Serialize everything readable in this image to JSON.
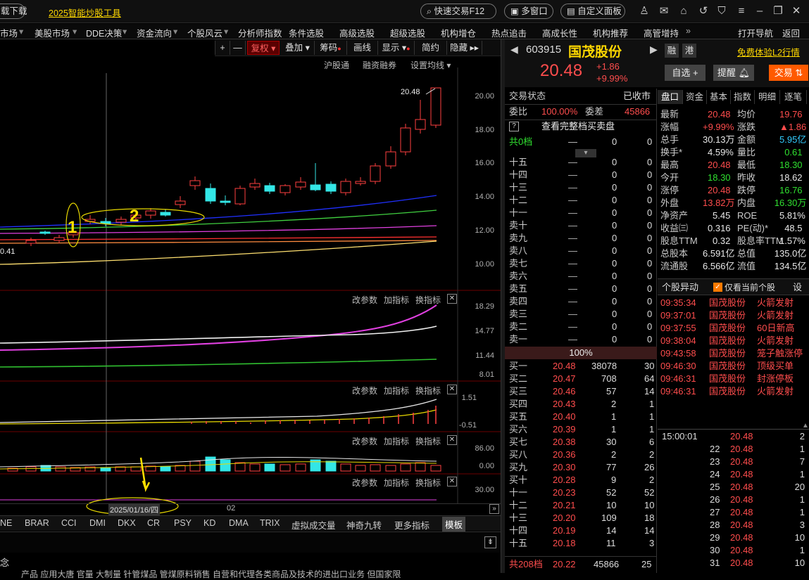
{
  "top": {
    "download": "载下载",
    "promo": "2025智能炒股工具",
    "quick_trade": "快速交易F12",
    "multi_window": "多窗口",
    "custom_panel": "自定义面板"
  },
  "menu": [
    "市场",
    "美股市场",
    "DDE决策",
    "资金流向",
    "个股风云",
    "分析师指数",
    "条件选股",
    "高级选股",
    "超级选股",
    "机构增仓",
    "热点追击",
    "高成长性",
    "机构推荐",
    "高管增持",
    "»",
    "打开导航",
    "返回"
  ],
  "chart_toolbar": {
    "plus": "+",
    "minus": "—",
    "fuquan": "复权",
    "diejia": "叠加",
    "chouma": "筹码",
    "huaxian": "画线",
    "xianshi": "显示",
    "jianyue": "简约",
    "yincang": "隐藏"
  },
  "chart_sub": {
    "hgt": "沪股通",
    "rzrq": "融资融券",
    "ma_set": "设置均线"
  },
  "price_axis": [
    "20.00",
    "18.00",
    "16.00",
    "14.00",
    "12.00",
    "10.00"
  ],
  "high_label": "20.48",
  "low_label": "0.41",
  "annot": {
    "one": "1",
    "two": "2",
    "date": "2025/01/16/四",
    "xdate": "02"
  },
  "ind_btns": {
    "gai": "改参数",
    "jia": "加指标",
    "huan": "换指标"
  },
  "ind1_axis": [
    "18.29",
    "14.77",
    "11.44",
    "8.01"
  ],
  "ind2_axis": [
    "1.51",
    "-0.51"
  ],
  "ind3_axis": [
    "86.00",
    "0.00"
  ],
  "ind4_axis": [
    "30.00"
  ],
  "ind_tabs": [
    "NE",
    "BRAR",
    "CCI",
    "DMI",
    "DKX",
    "CR",
    "PSY",
    "KD",
    "DMA",
    "TRIX",
    "虚拟成交量",
    "神奇九转",
    "更多指标",
    "模板"
  ],
  "bottom_text": {
    "concept": "念",
    "news": "产品  应用大唐  官量  大制量  针管煤品  管煤原料销售 自营和代理各类商品及技术的进出口业务 但国家限"
  },
  "stock": {
    "code": "603915",
    "name": "国茂股份",
    "tag1": "融",
    "tag2": "港",
    "l2": "免费体验L2行情",
    "price": "20.48",
    "chg": "+1.86",
    "pct": "+9.99%",
    "zixuan": "自选 +",
    "tixing": "提醒",
    "jiaoyi": "交易"
  },
  "ob_head": {
    "status_l": "交易状态",
    "status_r": "已收市",
    "weibi_l": "委比",
    "weibi_v": "100.00%",
    "weicha_l": "委差",
    "weicha_v": "45866",
    "full": "查看完整档买卖盘",
    "q": "?",
    "total_sell_l": "共0档",
    "total_sell_a": "—",
    "total_sell_b": "0",
    "total_sell_c": "0"
  },
  "sells": [
    [
      "十五",
      "—",
      "0",
      "0"
    ],
    [
      "十四",
      "—",
      "0",
      "0"
    ],
    [
      "十三",
      "—",
      "0",
      "0"
    ],
    [
      "十二",
      "—",
      "0",
      "0"
    ],
    [
      "十一",
      "—",
      "0",
      "0"
    ],
    [
      "卖十",
      "—",
      "0",
      "0"
    ],
    [
      "卖九",
      "—",
      "0",
      "0"
    ],
    [
      "卖八",
      "—",
      "0",
      "0"
    ],
    [
      "卖七",
      "—",
      "0",
      "0"
    ],
    [
      "卖六",
      "—",
      "0",
      "0"
    ],
    [
      "卖五",
      "—",
      "0",
      "0"
    ],
    [
      "卖四",
      "—",
      "0",
      "0"
    ],
    [
      "卖三",
      "—",
      "0",
      "0"
    ],
    [
      "卖二",
      "—",
      "0",
      "0"
    ],
    [
      "卖一",
      "—",
      "0",
      "0"
    ]
  ],
  "ratio": "100%",
  "buys": [
    [
      "买一",
      "20.48",
      "38078",
      "30"
    ],
    [
      "买二",
      "20.47",
      "708",
      "64"
    ],
    [
      "买三",
      "20.46",
      "57",
      "14"
    ],
    [
      "买四",
      "20.43",
      "2",
      "1"
    ],
    [
      "买五",
      "20.40",
      "1",
      "1"
    ],
    [
      "买六",
      "20.39",
      "1",
      "1"
    ],
    [
      "买七",
      "20.38",
      "30",
      "6"
    ],
    [
      "买八",
      "20.36",
      "2",
      "2"
    ],
    [
      "买九",
      "20.30",
      "77",
      "26"
    ],
    [
      "买十",
      "20.28",
      "9",
      "2"
    ],
    [
      "十一",
      "20.23",
      "52",
      "52"
    ],
    [
      "十二",
      "20.21",
      "10",
      "10"
    ],
    [
      "十三",
      "20.20",
      "109",
      "18"
    ],
    [
      "十四",
      "20.19",
      "14",
      "14"
    ],
    [
      "十五",
      "20.18",
      "11",
      "3"
    ]
  ],
  "total_buy": {
    "l": "共208档",
    "p": "20.22",
    "v": "45866",
    "n": "25"
  },
  "tabs": [
    "盘口",
    "资金",
    "基本",
    "指数",
    "明细",
    "逐笔"
  ],
  "quote": [
    [
      "最新",
      "20.48",
      "均价",
      "19.76"
    ],
    [
      "涨幅",
      "+9.99%",
      "涨跌",
      "▲1.86"
    ],
    [
      "总手",
      "30.13万",
      "金额",
      "5.95亿"
    ],
    [
      "换手*",
      "4.59%",
      "量比",
      "0.61"
    ],
    [
      "最高",
      "20.48",
      "最低",
      "18.30"
    ],
    [
      "今开",
      "18.30",
      "昨收",
      "18.62"
    ],
    [
      "涨停",
      "20.48",
      "跌停",
      "16.76"
    ],
    [
      "外盘",
      "13.82万",
      "内盘",
      "16.30万"
    ],
    [
      "净资产",
      "5.45",
      "ROE",
      "5.81%"
    ],
    [
      "收益㈢",
      "0.316",
      "PE(动)*",
      "48.5"
    ],
    [
      "股息TTM",
      "0.32",
      "股息率TTM",
      "1.57%"
    ],
    [
      "总股本",
      "6.591亿",
      "总值",
      "135.0亿"
    ],
    [
      "流通股",
      "6.566亿",
      "流值",
      "134.5亿"
    ]
  ],
  "events_head": {
    "title": "个股异动",
    "only": "仅看当前个股",
    "set": "设"
  },
  "events": [
    [
      "09:35:34",
      "国茂股份",
      "火箭发射"
    ],
    [
      "09:37:01",
      "国茂股份",
      "火箭发射"
    ],
    [
      "09:37:55",
      "国茂股份",
      "60日新高"
    ],
    [
      "09:38:04",
      "国茂股份",
      "火箭发射"
    ],
    [
      "09:43:58",
      "国茂股份",
      "笼子触涨停"
    ],
    [
      "09:46:30",
      "国茂股份",
      "顶级买单"
    ],
    [
      "09:46:31",
      "国茂股份",
      "封涨停板"
    ],
    [
      "09:46:31",
      "国茂股份",
      "火箭发射"
    ]
  ],
  "ticks": [
    [
      "15:00:01",
      "20.48",
      "2"
    ],
    [
      "22",
      "20.48",
      "1"
    ],
    [
      "23",
      "20.48",
      "7"
    ],
    [
      "24",
      "20.48",
      "1"
    ],
    [
      "25",
      "20.48",
      "20"
    ],
    [
      "26",
      "20.48",
      "1"
    ],
    [
      "27",
      "20.48",
      "1"
    ],
    [
      "28",
      "20.48",
      "3"
    ],
    [
      "29",
      "20.48",
      "10"
    ],
    [
      "30",
      "20.48",
      "1"
    ],
    [
      "31",
      "20.48",
      "10"
    ]
  ]
}
